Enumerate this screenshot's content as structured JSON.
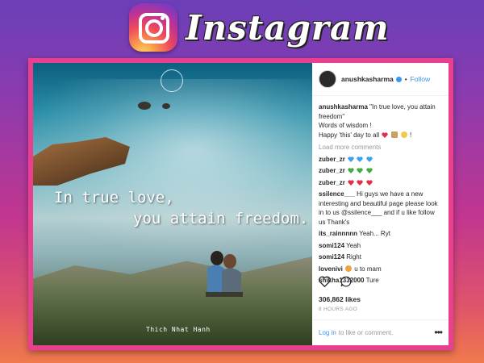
{
  "brand": {
    "wordmark": "Instagram"
  },
  "photo": {
    "quote_line1": "In true love,",
    "quote_line2": "you attain freedom.",
    "credit": "Thich Nhat Hanh"
  },
  "post": {
    "username": "anushkasharma",
    "separator": "•",
    "follow_label": "Follow",
    "caption_user": "anushkasharma",
    "caption_line1": "\"In true love, you attain freedom\"",
    "caption_line2": "Words of wisdom !",
    "caption_line3": "Happy 'this' day to all",
    "load_more": "Load more comments",
    "comments": [
      {
        "user": "zuber_zr",
        "text": ""
      },
      {
        "user": "zuber_zr",
        "text": ""
      },
      {
        "user": "zuber_zr",
        "text": ""
      },
      {
        "user": "ssilence___",
        "text": "Hi guys we have a new interesting and beautiful page please look in to us @ssilence___ and if u like follow us Thank's"
      },
      {
        "user": "its_rainnnnn",
        "text": "Yeah... Ryt"
      },
      {
        "user": "somi124",
        "text": "Yeah"
      },
      {
        "user": "somi124",
        "text": "Right"
      },
      {
        "user": "lovenivi",
        "text": "u to mam"
      },
      {
        "user": "shikha1332000",
        "text": "Ture"
      }
    ],
    "likes": "306,862 likes",
    "time": "8 HOURS AGO",
    "login_link": "Log in",
    "login_rest": "to like or comment.",
    "more_dots": "•••"
  },
  "colors": {
    "accent_blue": "#3897f0",
    "frame_pink": "#e83f8f",
    "heart_blue": "#3da3e8",
    "heart_green": "#3fae3f",
    "heart_red": "#e0304a"
  },
  "icons": [
    "instagram-logo-icon",
    "verified-badge-icon",
    "heart-icon",
    "comment-icon",
    "more-options-icon"
  ]
}
